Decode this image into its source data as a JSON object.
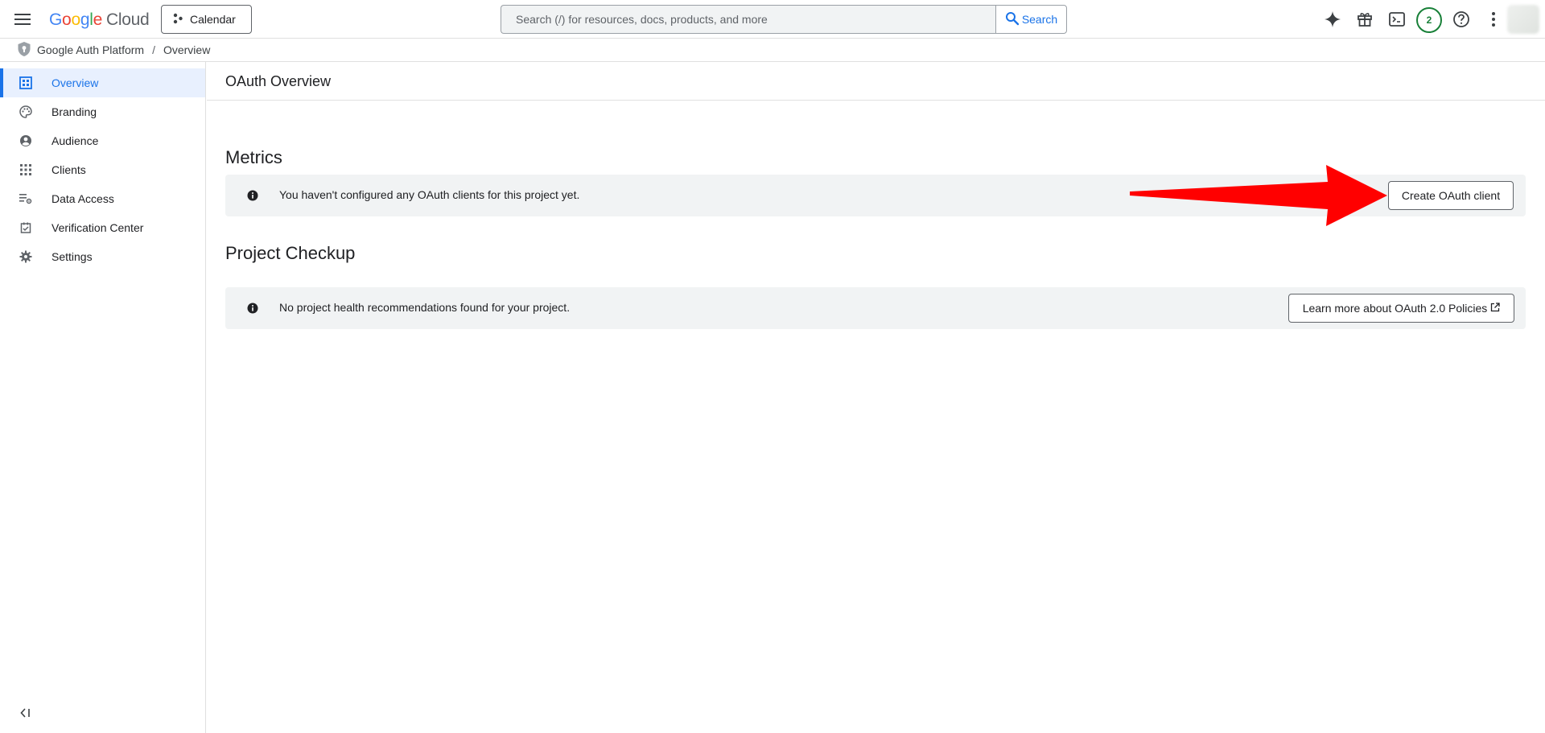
{
  "header": {
    "logo": {
      "g": "G",
      "o1": "o",
      "o2": "o",
      "g2": "g",
      "l": "l",
      "e": "e",
      "cloud": "Cloud"
    },
    "project_label": "Calendar",
    "search": {
      "placeholder": "Search (/) for resources, docs, products, and more",
      "button_label": "Search"
    },
    "notifications_count": "2"
  },
  "breadcrumb": {
    "parent": "Google Auth Platform",
    "separator": "/",
    "current": "Overview"
  },
  "sidebar": {
    "items": [
      {
        "label": "Overview",
        "icon": "dashboard-icon",
        "active": true
      },
      {
        "label": "Branding",
        "icon": "palette-icon"
      },
      {
        "label": "Audience",
        "icon": "account-circle-icon"
      },
      {
        "label": "Clients",
        "icon": "apps-grid-icon"
      },
      {
        "label": "Data Access",
        "icon": "data-access-icon"
      },
      {
        "label": "Verification Center",
        "icon": "verification-icon"
      },
      {
        "label": "Settings",
        "icon": "gear-icon"
      }
    ]
  },
  "main": {
    "page_title": "OAuth Overview",
    "metrics": {
      "title": "Metrics",
      "message": "You haven't configured any OAuth clients for this project yet.",
      "button_label": "Create OAuth client"
    },
    "checkup": {
      "title": "Project Checkup",
      "message": "No project health recommendations found for your project.",
      "button_label": "Learn more about OAuth 2.0 Policies"
    }
  },
  "colors": {
    "accent": "#1a73e8",
    "active_bg": "#e8f0fe",
    "panel_bg": "#f1f3f4",
    "badge_green": "#188038",
    "annotation_arrow": "#ff0000"
  }
}
